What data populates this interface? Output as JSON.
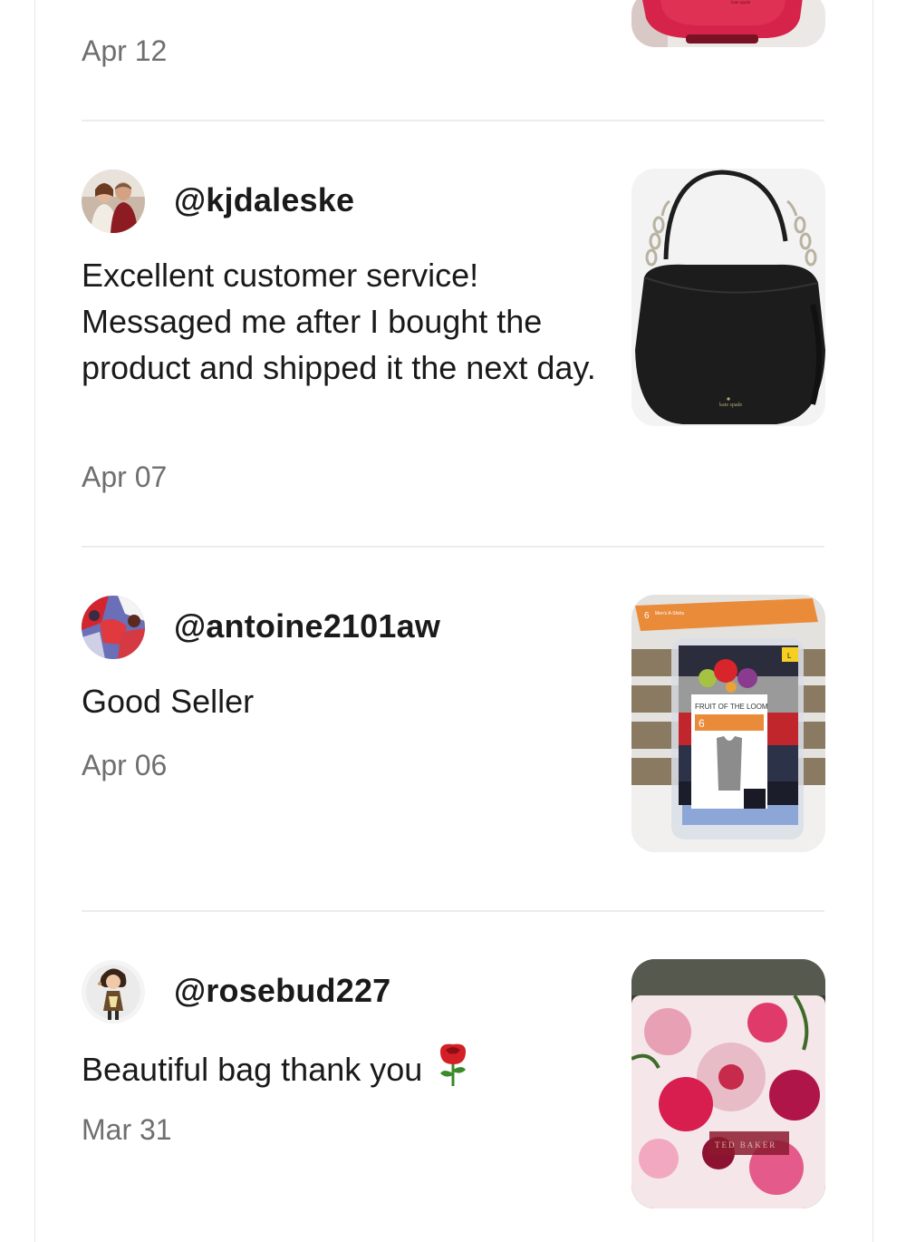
{
  "reviews": [
    {
      "username": "",
      "text": "",
      "date": "Apr 12",
      "product_image": "pink-kate-spade-bag"
    },
    {
      "username": "@kjdaleske",
      "text": "Excellent customer service! Messaged me after I bought the product and shipped it the next day.",
      "date": "Apr 07",
      "avatar": "couple-photo",
      "product_image": "black-kate-spade-hobo-bag"
    },
    {
      "username": "@antoine2101aw",
      "text": "Good Seller",
      "date": "Apr 06",
      "avatar": "colorful-photo",
      "product_image": "fruit-of-the-loom-a-shirts-pack",
      "product_labels": {
        "count": "6",
        "count_small": "6",
        "type": "Men's A-Shirts",
        "brand": "FRUIT OF THE LOOM",
        "size": "L"
      }
    },
    {
      "username": "@rosebud227",
      "text": "Beautiful bag thank you",
      "emoji": "rose-icon",
      "date": "Mar 31",
      "avatar": "cartoon-girl",
      "product_image": "ted-baker-floral-pouch",
      "product_labels": {
        "brand": "TED BAKER"
      }
    }
  ]
}
